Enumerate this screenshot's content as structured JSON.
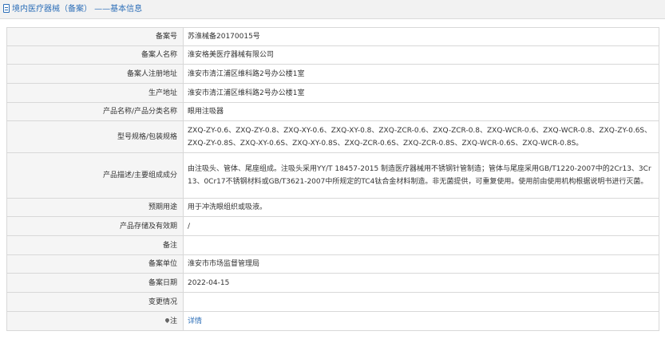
{
  "header": {
    "title": "境内医疗器械（备案） ——基本信息"
  },
  "rows": [
    {
      "label": "备案号",
      "value": "苏淮械备20170015号"
    },
    {
      "label": "备案人名称",
      "value": "淮安格美医疗器械有限公司"
    },
    {
      "label": "备案人注册地址",
      "value": "淮安市清江浦区维科路2号办公楼1室"
    },
    {
      "label": "生产地址",
      "value": "淮安市清江浦区维科路2号办公楼1室"
    },
    {
      "label": "产品名称/产品分类名称",
      "value": "眼用注吸器"
    },
    {
      "label": "型号规格/包装规格",
      "value": "ZXQ-ZY-0.6、ZXQ-ZY-0.8、ZXQ-XY-0.6、ZXQ-XY-0.8、ZXQ-ZCR-0.6、ZXQ-ZCR-0.8、ZXQ-WCR-0.6、ZXQ-WCR-0.8、ZXQ-ZY-0.6S、ZXQ-ZY-0.8S、ZXQ-XY-0.6S、ZXQ-XY-0.8S、ZXQ-ZCR-0.6S、ZXQ-ZCR-0.8S、ZXQ-WCR-0.6S、ZXQ-WCR-0.8S。"
    },
    {
      "label": "产品描述/主要组成成分",
      "value": "由注吸头、管体、尾座组成。注吸头采用YY/T 18457-2015 制造医疗器械用不锈钢针管制造；管体与尾座采用GB/T1220-2007中的2Cr13、3Cr13、0Cr17不锈钢材料或GB/T3621-2007中所规定的TC4钛合金材料制造。非无菌提供，可重复使用。使用前由使用机构根据说明书进行灭菌。"
    },
    {
      "label": "预期用途",
      "value": "用于冲洗眼组织或吸液。"
    },
    {
      "label": "产品存储及有效期",
      "value": "/"
    },
    {
      "label": "备注",
      "value": ""
    },
    {
      "label": "备案单位",
      "value": "淮安市市场监督管理局"
    },
    {
      "label": "备案日期",
      "value": "2022-04-15"
    },
    {
      "label": "变更情况",
      "value": ""
    }
  ],
  "note": {
    "label": "注",
    "link_text": "详情",
    "icon": "pin-icon"
  },
  "colors": {
    "accent": "#2d6fb8",
    "label_bg": "#f5f5f5",
    "border": "#d8d8d8"
  }
}
